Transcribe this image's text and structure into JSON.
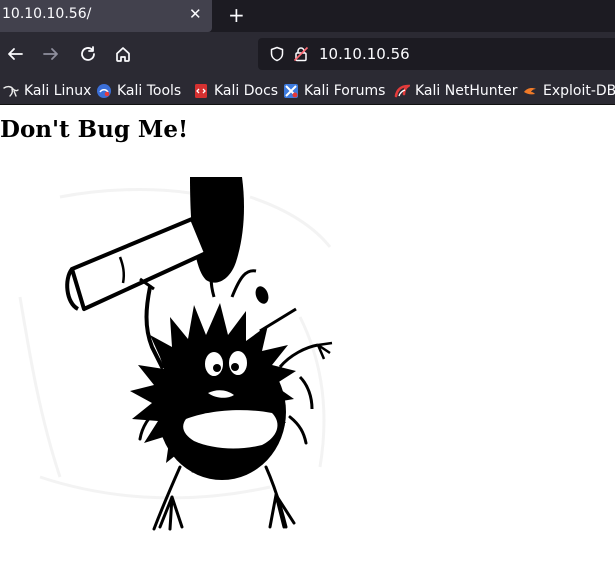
{
  "tab": {
    "title": "10.10.10.56/",
    "close_glyph": "✕",
    "new_tab_glyph": "+"
  },
  "nav": {
    "back_icon": "back-arrow-icon",
    "forward_icon": "forward-arrow-icon",
    "reload_icon": "reload-icon",
    "home_icon": "home-icon",
    "url": "10.10.10.56"
  },
  "bookmarks": [
    {
      "label": "Kali Linux",
      "icon": "kali-dragon-icon"
    },
    {
      "label": "Kali Tools",
      "icon": "kali-tools-icon"
    },
    {
      "label": "Kali Docs",
      "icon": "kali-docs-icon"
    },
    {
      "label": "Kali Forums",
      "icon": "kali-forums-icon"
    },
    {
      "label": "Kali NetHunter",
      "icon": "kali-nethunter-icon"
    },
    {
      "label": "Exploit-DB",
      "icon": "exploit-db-icon"
    }
  ],
  "page": {
    "heading": "Don't Bug Me!"
  },
  "colors": {
    "tabbar": "#1c1b22",
    "toolbar": "#2b2a33",
    "tab_active": "#42414d",
    "text": "#fbfbfe"
  }
}
